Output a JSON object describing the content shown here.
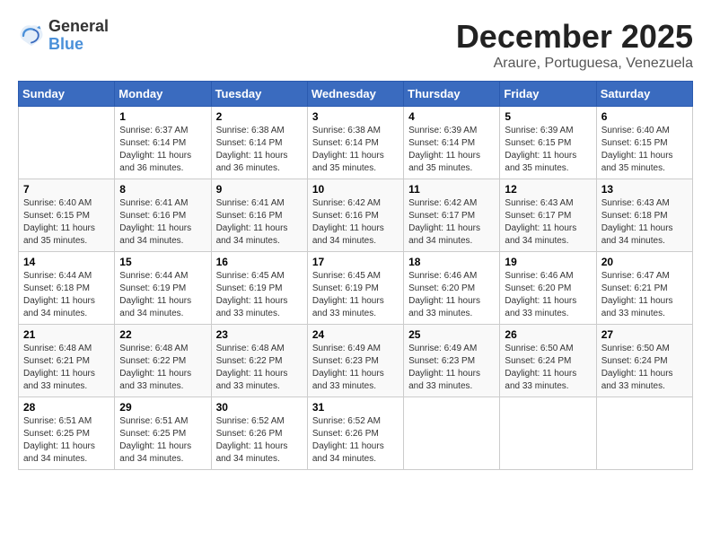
{
  "header": {
    "logo": {
      "general": "General",
      "blue": "Blue"
    },
    "title": "December 2025",
    "location": "Araure, Portuguesa, Venezuela"
  },
  "calendar": {
    "days_of_week": [
      "Sunday",
      "Monday",
      "Tuesday",
      "Wednesday",
      "Thursday",
      "Friday",
      "Saturday"
    ],
    "weeks": [
      [
        {
          "day": "",
          "sunrise": "",
          "sunset": "",
          "daylight": ""
        },
        {
          "day": "1",
          "sunrise": "Sunrise: 6:37 AM",
          "sunset": "Sunset: 6:14 PM",
          "daylight": "Daylight: 11 hours and 36 minutes."
        },
        {
          "day": "2",
          "sunrise": "Sunrise: 6:38 AM",
          "sunset": "Sunset: 6:14 PM",
          "daylight": "Daylight: 11 hours and 36 minutes."
        },
        {
          "day": "3",
          "sunrise": "Sunrise: 6:38 AM",
          "sunset": "Sunset: 6:14 PM",
          "daylight": "Daylight: 11 hours and 35 minutes."
        },
        {
          "day": "4",
          "sunrise": "Sunrise: 6:39 AM",
          "sunset": "Sunset: 6:14 PM",
          "daylight": "Daylight: 11 hours and 35 minutes."
        },
        {
          "day": "5",
          "sunrise": "Sunrise: 6:39 AM",
          "sunset": "Sunset: 6:15 PM",
          "daylight": "Daylight: 11 hours and 35 minutes."
        },
        {
          "day": "6",
          "sunrise": "Sunrise: 6:40 AM",
          "sunset": "Sunset: 6:15 PM",
          "daylight": "Daylight: 11 hours and 35 minutes."
        }
      ],
      [
        {
          "day": "7",
          "sunrise": "Sunrise: 6:40 AM",
          "sunset": "Sunset: 6:15 PM",
          "daylight": "Daylight: 11 hours and 35 minutes."
        },
        {
          "day": "8",
          "sunrise": "Sunrise: 6:41 AM",
          "sunset": "Sunset: 6:16 PM",
          "daylight": "Daylight: 11 hours and 34 minutes."
        },
        {
          "day": "9",
          "sunrise": "Sunrise: 6:41 AM",
          "sunset": "Sunset: 6:16 PM",
          "daylight": "Daylight: 11 hours and 34 minutes."
        },
        {
          "day": "10",
          "sunrise": "Sunrise: 6:42 AM",
          "sunset": "Sunset: 6:16 PM",
          "daylight": "Daylight: 11 hours and 34 minutes."
        },
        {
          "day": "11",
          "sunrise": "Sunrise: 6:42 AM",
          "sunset": "Sunset: 6:17 PM",
          "daylight": "Daylight: 11 hours and 34 minutes."
        },
        {
          "day": "12",
          "sunrise": "Sunrise: 6:43 AM",
          "sunset": "Sunset: 6:17 PM",
          "daylight": "Daylight: 11 hours and 34 minutes."
        },
        {
          "day": "13",
          "sunrise": "Sunrise: 6:43 AM",
          "sunset": "Sunset: 6:18 PM",
          "daylight": "Daylight: 11 hours and 34 minutes."
        }
      ],
      [
        {
          "day": "14",
          "sunrise": "Sunrise: 6:44 AM",
          "sunset": "Sunset: 6:18 PM",
          "daylight": "Daylight: 11 hours and 34 minutes."
        },
        {
          "day": "15",
          "sunrise": "Sunrise: 6:44 AM",
          "sunset": "Sunset: 6:19 PM",
          "daylight": "Daylight: 11 hours and 34 minutes."
        },
        {
          "day": "16",
          "sunrise": "Sunrise: 6:45 AM",
          "sunset": "Sunset: 6:19 PM",
          "daylight": "Daylight: 11 hours and 33 minutes."
        },
        {
          "day": "17",
          "sunrise": "Sunrise: 6:45 AM",
          "sunset": "Sunset: 6:19 PM",
          "daylight": "Daylight: 11 hours and 33 minutes."
        },
        {
          "day": "18",
          "sunrise": "Sunrise: 6:46 AM",
          "sunset": "Sunset: 6:20 PM",
          "daylight": "Daylight: 11 hours and 33 minutes."
        },
        {
          "day": "19",
          "sunrise": "Sunrise: 6:46 AM",
          "sunset": "Sunset: 6:20 PM",
          "daylight": "Daylight: 11 hours and 33 minutes."
        },
        {
          "day": "20",
          "sunrise": "Sunrise: 6:47 AM",
          "sunset": "Sunset: 6:21 PM",
          "daylight": "Daylight: 11 hours and 33 minutes."
        }
      ],
      [
        {
          "day": "21",
          "sunrise": "Sunrise: 6:48 AM",
          "sunset": "Sunset: 6:21 PM",
          "daylight": "Daylight: 11 hours and 33 minutes."
        },
        {
          "day": "22",
          "sunrise": "Sunrise: 6:48 AM",
          "sunset": "Sunset: 6:22 PM",
          "daylight": "Daylight: 11 hours and 33 minutes."
        },
        {
          "day": "23",
          "sunrise": "Sunrise: 6:48 AM",
          "sunset": "Sunset: 6:22 PM",
          "daylight": "Daylight: 11 hours and 33 minutes."
        },
        {
          "day": "24",
          "sunrise": "Sunrise: 6:49 AM",
          "sunset": "Sunset: 6:23 PM",
          "daylight": "Daylight: 11 hours and 33 minutes."
        },
        {
          "day": "25",
          "sunrise": "Sunrise: 6:49 AM",
          "sunset": "Sunset: 6:23 PM",
          "daylight": "Daylight: 11 hours and 33 minutes."
        },
        {
          "day": "26",
          "sunrise": "Sunrise: 6:50 AM",
          "sunset": "Sunset: 6:24 PM",
          "daylight": "Daylight: 11 hours and 33 minutes."
        },
        {
          "day": "27",
          "sunrise": "Sunrise: 6:50 AM",
          "sunset": "Sunset: 6:24 PM",
          "daylight": "Daylight: 11 hours and 33 minutes."
        }
      ],
      [
        {
          "day": "28",
          "sunrise": "Sunrise: 6:51 AM",
          "sunset": "Sunset: 6:25 PM",
          "daylight": "Daylight: 11 hours and 34 minutes."
        },
        {
          "day": "29",
          "sunrise": "Sunrise: 6:51 AM",
          "sunset": "Sunset: 6:25 PM",
          "daylight": "Daylight: 11 hours and 34 minutes."
        },
        {
          "day": "30",
          "sunrise": "Sunrise: 6:52 AM",
          "sunset": "Sunset: 6:26 PM",
          "daylight": "Daylight: 11 hours and 34 minutes."
        },
        {
          "day": "31",
          "sunrise": "Sunrise: 6:52 AM",
          "sunset": "Sunset: 6:26 PM",
          "daylight": "Daylight: 11 hours and 34 minutes."
        },
        {
          "day": "",
          "sunrise": "",
          "sunset": "",
          "daylight": ""
        },
        {
          "day": "",
          "sunrise": "",
          "sunset": "",
          "daylight": ""
        },
        {
          "day": "",
          "sunrise": "",
          "sunset": "",
          "daylight": ""
        }
      ]
    ]
  }
}
